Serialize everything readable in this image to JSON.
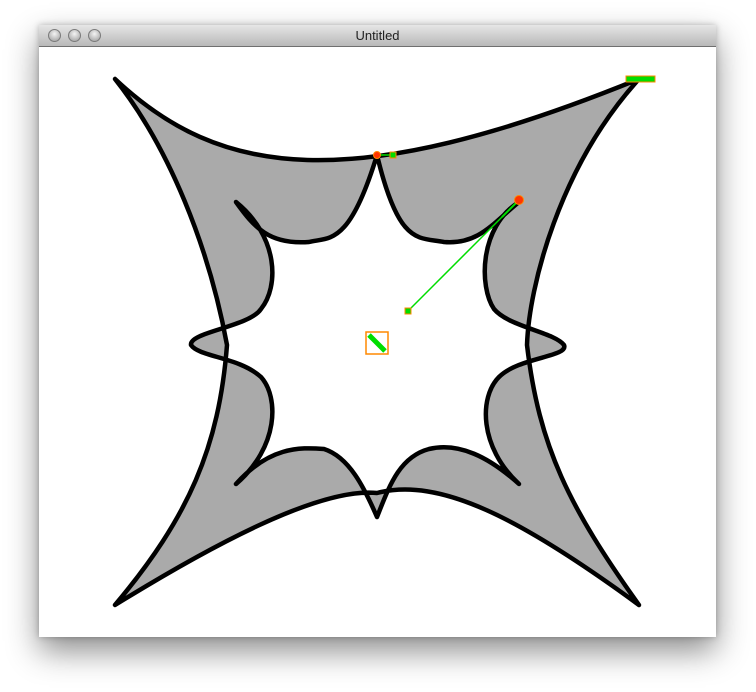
{
  "window": {
    "title": "Untitled",
    "controls": {
      "close": "close-icon",
      "minimize": "minimize-icon",
      "zoom": "zoom-icon"
    }
  },
  "canvas": {
    "shape_fill": "#aaaaaa",
    "stroke_color": "#000000",
    "handle_line_color": "#00dd00",
    "handle_outline_color": "#ff8800",
    "anchor_color": "#ff3300"
  }
}
